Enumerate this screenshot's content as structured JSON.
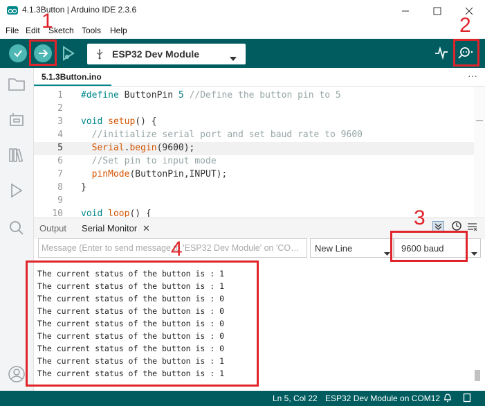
{
  "window": {
    "title": "4.1.3Button | Arduino IDE 2.3.6"
  },
  "menu": [
    "File",
    "Edit",
    "Sketch",
    "Tools",
    "Help"
  ],
  "toolbar": {
    "board": "ESP32 Dev Module"
  },
  "editor": {
    "file_tab": "5.1.3Button.ino",
    "more_label": "···",
    "lines": [
      {
        "n": "1",
        "code": "#define ButtonPin 5 //Define the button pin to 5"
      },
      {
        "n": "2",
        "code": ""
      },
      {
        "n": "3",
        "code": "void setup() {"
      },
      {
        "n": "4",
        "code": "  //initialize serial port and set baud rate to 9600"
      },
      {
        "n": "5",
        "code": "  Serial.begin(9600);"
      },
      {
        "n": "6",
        "code": "  //Set pin to input mode"
      },
      {
        "n": "7",
        "code": "  pinMode(ButtonPin,INPUT);"
      },
      {
        "n": "8",
        "code": "}"
      },
      {
        "n": "9",
        "code": ""
      },
      {
        "n": "10",
        "code": "void loop() {"
      }
    ]
  },
  "panel": {
    "tabs": [
      "Output",
      "Serial Monitor"
    ],
    "close_glyph": "✕",
    "message_placeholder": "Message (Enter to send message to 'ESP32 Dev Module' on 'CO…",
    "line_ending": "New Line",
    "baud": "9600 baud"
  },
  "serial_output": [
    "The current status of the button is : 1",
    "The current status of the button is : 1",
    "The current status of the button is : 0",
    "The current status of the button is : 0",
    "The current status of the button is : 0",
    "The current status of the button is : 0",
    "The current status of the button is : 0",
    "The current status of the button is : 1",
    "The current status of the button is : 1"
  ],
  "statusbar": {
    "position": "Ln 5, Col 22",
    "board_port": "ESP32 Dev Module on COM12"
  },
  "annotations": [
    "1",
    "2",
    "3",
    "4"
  ],
  "colors": {
    "toolbar": "#005c5f",
    "accent": "#00878a",
    "annotation": "#e0242b"
  }
}
